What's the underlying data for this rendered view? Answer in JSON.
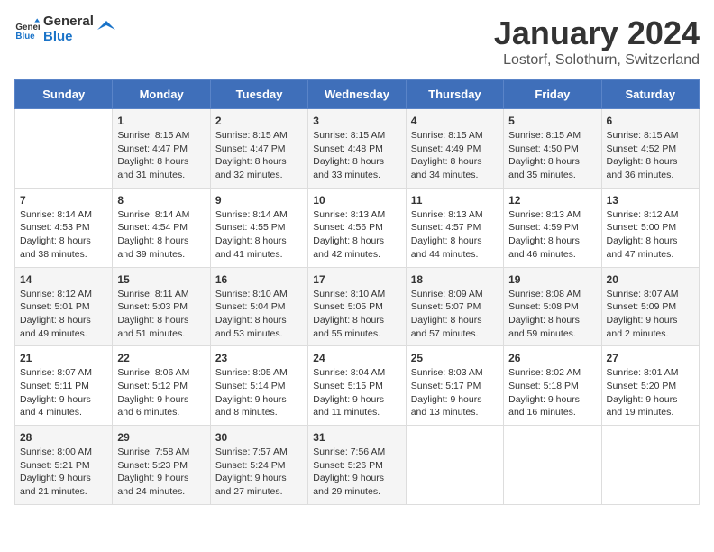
{
  "header": {
    "logo_line1": "General",
    "logo_line2": "Blue",
    "title": "January 2024",
    "subtitle": "Lostorf, Solothurn, Switzerland"
  },
  "days_of_week": [
    "Sunday",
    "Monday",
    "Tuesday",
    "Wednesday",
    "Thursday",
    "Friday",
    "Saturday"
  ],
  "weeks": [
    [
      {
        "day": "",
        "sunrise": "",
        "sunset": "",
        "daylight": ""
      },
      {
        "day": "1",
        "sunrise": "Sunrise: 8:15 AM",
        "sunset": "Sunset: 4:47 PM",
        "daylight": "Daylight: 8 hours and 31 minutes."
      },
      {
        "day": "2",
        "sunrise": "Sunrise: 8:15 AM",
        "sunset": "Sunset: 4:47 PM",
        "daylight": "Daylight: 8 hours and 32 minutes."
      },
      {
        "day": "3",
        "sunrise": "Sunrise: 8:15 AM",
        "sunset": "Sunset: 4:48 PM",
        "daylight": "Daylight: 8 hours and 33 minutes."
      },
      {
        "day": "4",
        "sunrise": "Sunrise: 8:15 AM",
        "sunset": "Sunset: 4:49 PM",
        "daylight": "Daylight: 8 hours and 34 minutes."
      },
      {
        "day": "5",
        "sunrise": "Sunrise: 8:15 AM",
        "sunset": "Sunset: 4:50 PM",
        "daylight": "Daylight: 8 hours and 35 minutes."
      },
      {
        "day": "6",
        "sunrise": "Sunrise: 8:15 AM",
        "sunset": "Sunset: 4:52 PM",
        "daylight": "Daylight: 8 hours and 36 minutes."
      }
    ],
    [
      {
        "day": "7",
        "sunrise": "Sunrise: 8:14 AM",
        "sunset": "Sunset: 4:53 PM",
        "daylight": "Daylight: 8 hours and 38 minutes."
      },
      {
        "day": "8",
        "sunrise": "Sunrise: 8:14 AM",
        "sunset": "Sunset: 4:54 PM",
        "daylight": "Daylight: 8 hours and 39 minutes."
      },
      {
        "day": "9",
        "sunrise": "Sunrise: 8:14 AM",
        "sunset": "Sunset: 4:55 PM",
        "daylight": "Daylight: 8 hours and 41 minutes."
      },
      {
        "day": "10",
        "sunrise": "Sunrise: 8:13 AM",
        "sunset": "Sunset: 4:56 PM",
        "daylight": "Daylight: 8 hours and 42 minutes."
      },
      {
        "day": "11",
        "sunrise": "Sunrise: 8:13 AM",
        "sunset": "Sunset: 4:57 PM",
        "daylight": "Daylight: 8 hours and 44 minutes."
      },
      {
        "day": "12",
        "sunrise": "Sunrise: 8:13 AM",
        "sunset": "Sunset: 4:59 PM",
        "daylight": "Daylight: 8 hours and 46 minutes."
      },
      {
        "day": "13",
        "sunrise": "Sunrise: 8:12 AM",
        "sunset": "Sunset: 5:00 PM",
        "daylight": "Daylight: 8 hours and 47 minutes."
      }
    ],
    [
      {
        "day": "14",
        "sunrise": "Sunrise: 8:12 AM",
        "sunset": "Sunset: 5:01 PM",
        "daylight": "Daylight: 8 hours and 49 minutes."
      },
      {
        "day": "15",
        "sunrise": "Sunrise: 8:11 AM",
        "sunset": "Sunset: 5:03 PM",
        "daylight": "Daylight: 8 hours and 51 minutes."
      },
      {
        "day": "16",
        "sunrise": "Sunrise: 8:10 AM",
        "sunset": "Sunset: 5:04 PM",
        "daylight": "Daylight: 8 hours and 53 minutes."
      },
      {
        "day": "17",
        "sunrise": "Sunrise: 8:10 AM",
        "sunset": "Sunset: 5:05 PM",
        "daylight": "Daylight: 8 hours and 55 minutes."
      },
      {
        "day": "18",
        "sunrise": "Sunrise: 8:09 AM",
        "sunset": "Sunset: 5:07 PM",
        "daylight": "Daylight: 8 hours and 57 minutes."
      },
      {
        "day": "19",
        "sunrise": "Sunrise: 8:08 AM",
        "sunset": "Sunset: 5:08 PM",
        "daylight": "Daylight: 8 hours and 59 minutes."
      },
      {
        "day": "20",
        "sunrise": "Sunrise: 8:07 AM",
        "sunset": "Sunset: 5:09 PM",
        "daylight": "Daylight: 9 hours and 2 minutes."
      }
    ],
    [
      {
        "day": "21",
        "sunrise": "Sunrise: 8:07 AM",
        "sunset": "Sunset: 5:11 PM",
        "daylight": "Daylight: 9 hours and 4 minutes."
      },
      {
        "day": "22",
        "sunrise": "Sunrise: 8:06 AM",
        "sunset": "Sunset: 5:12 PM",
        "daylight": "Daylight: 9 hours and 6 minutes."
      },
      {
        "day": "23",
        "sunrise": "Sunrise: 8:05 AM",
        "sunset": "Sunset: 5:14 PM",
        "daylight": "Daylight: 9 hours and 8 minutes."
      },
      {
        "day": "24",
        "sunrise": "Sunrise: 8:04 AM",
        "sunset": "Sunset: 5:15 PM",
        "daylight": "Daylight: 9 hours and 11 minutes."
      },
      {
        "day": "25",
        "sunrise": "Sunrise: 8:03 AM",
        "sunset": "Sunset: 5:17 PM",
        "daylight": "Daylight: 9 hours and 13 minutes."
      },
      {
        "day": "26",
        "sunrise": "Sunrise: 8:02 AM",
        "sunset": "Sunset: 5:18 PM",
        "daylight": "Daylight: 9 hours and 16 minutes."
      },
      {
        "day": "27",
        "sunrise": "Sunrise: 8:01 AM",
        "sunset": "Sunset: 5:20 PM",
        "daylight": "Daylight: 9 hours and 19 minutes."
      }
    ],
    [
      {
        "day": "28",
        "sunrise": "Sunrise: 8:00 AM",
        "sunset": "Sunset: 5:21 PM",
        "daylight": "Daylight: 9 hours and 21 minutes."
      },
      {
        "day": "29",
        "sunrise": "Sunrise: 7:58 AM",
        "sunset": "Sunset: 5:23 PM",
        "daylight": "Daylight: 9 hours and 24 minutes."
      },
      {
        "day": "30",
        "sunrise": "Sunrise: 7:57 AM",
        "sunset": "Sunset: 5:24 PM",
        "daylight": "Daylight: 9 hours and 27 minutes."
      },
      {
        "day": "31",
        "sunrise": "Sunrise: 7:56 AM",
        "sunset": "Sunset: 5:26 PM",
        "daylight": "Daylight: 9 hours and 29 minutes."
      },
      {
        "day": "",
        "sunrise": "",
        "sunset": "",
        "daylight": ""
      },
      {
        "day": "",
        "sunrise": "",
        "sunset": "",
        "daylight": ""
      },
      {
        "day": "",
        "sunrise": "",
        "sunset": "",
        "daylight": ""
      }
    ]
  ]
}
